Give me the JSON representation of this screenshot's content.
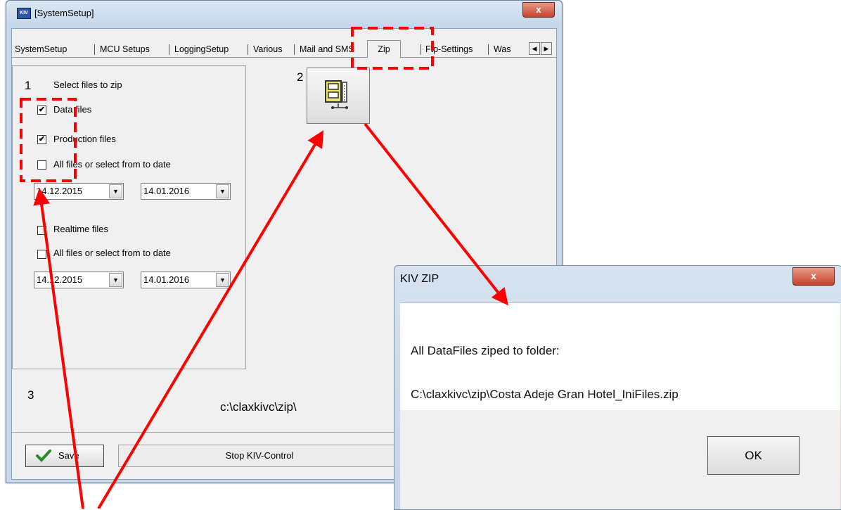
{
  "window": {
    "title": "[SystemSetup]",
    "close_label": "x",
    "app_icon_label": "KIV"
  },
  "tabs": [
    {
      "label": "SystemSetup"
    },
    {
      "label": "MCU Setups"
    },
    {
      "label": "LoggingSetup"
    },
    {
      "label": "Various"
    },
    {
      "label": "Mail and SMS"
    },
    {
      "label": "Zip",
      "active": true
    },
    {
      "label": "Ftp-Settings"
    },
    {
      "label": "Was"
    }
  ],
  "tab_scroll": {
    "left": "◀",
    "right": "▶"
  },
  "section1": {
    "number": "1",
    "title": "Select files to zip",
    "data_files": {
      "label": "Data files",
      "checked": true
    },
    "production_files": {
      "label": "Production files",
      "checked": true
    },
    "all_files_1": {
      "label": "All files or select from to date",
      "checked": false
    },
    "date_from_1": "14.12.2015",
    "date_to_1": "14.01.2016",
    "realtime_files": {
      "label": "Realtime files",
      "checked": false
    },
    "all_files_2": {
      "label": "All files or select from to date",
      "checked": false
    },
    "date_from_2": "14.12.2015",
    "date_to_2": "14.01.2016"
  },
  "section2": {
    "number": "2",
    "zip_icon": "zip-archive-icon"
  },
  "section3": {
    "number": "3",
    "path": "c:\\claxkivc\\zip\\"
  },
  "buttons": {
    "save": "Save",
    "stop": "Stop KIV-Control"
  },
  "dialog": {
    "title": "KIV ZIP",
    "close_label": "x",
    "message_line1": "All DataFiles ziped to folder:",
    "message_line2": "C:\\claxkivc\\zip\\Costa Adeje Gran Hotel_IniFiles.zip",
    "ok": "OK"
  },
  "annotations": {
    "color": "#ff0000"
  }
}
